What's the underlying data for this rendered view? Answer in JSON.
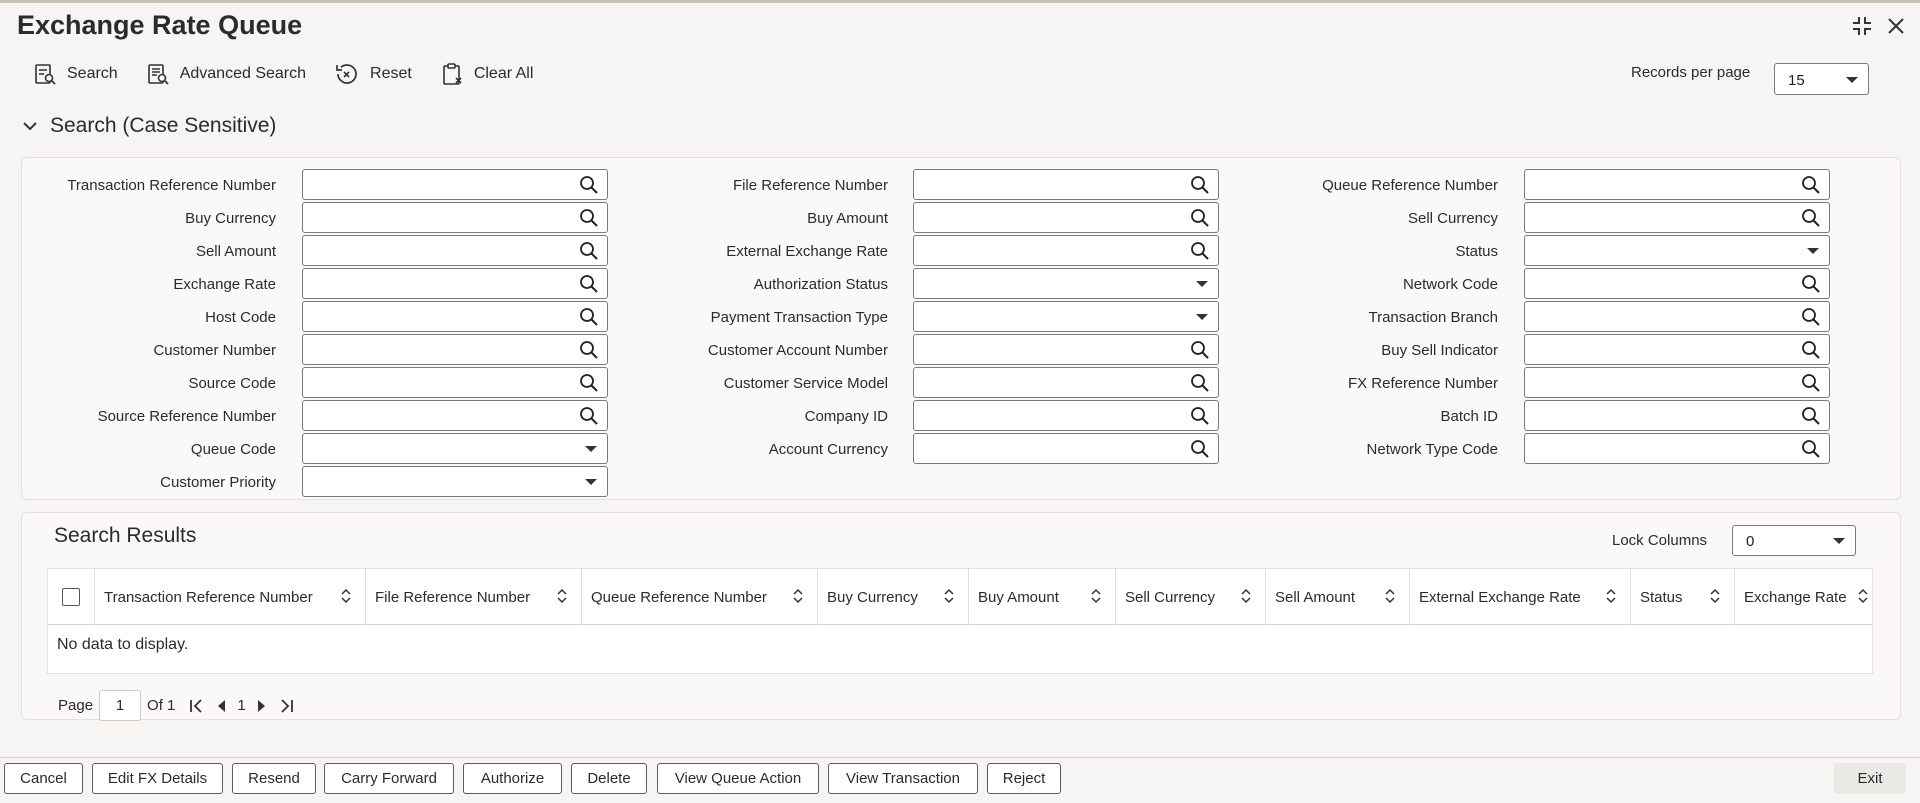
{
  "window": {
    "title": "Exchange Rate Queue"
  },
  "toolbar": {
    "search_label": "Search",
    "advanced_search_label": "Advanced Search",
    "reset_label": "Reset",
    "clear_all_label": "Clear All",
    "records_per_page_label": "Records per page",
    "records_per_page_value": "15"
  },
  "search_section": {
    "title": "Search (Case Sensitive)",
    "fields": {
      "transaction_reference_number": "Transaction Reference Number",
      "buy_currency": "Buy Currency",
      "sell_amount": "Sell Amount",
      "exchange_rate": "Exchange Rate",
      "host_code": "Host Code",
      "customer_number": "Customer Number",
      "source_code": "Source Code",
      "source_reference_number": "Source Reference Number",
      "queue_code": "Queue Code",
      "customer_priority": "Customer Priority",
      "file_reference_number": "File Reference Number",
      "buy_amount": "Buy Amount",
      "external_exchange_rate": "External Exchange Rate",
      "authorization_status": "Authorization Status",
      "payment_transaction_type": "Payment Transaction Type",
      "customer_account_number": "Customer Account Number",
      "customer_service_model": "Customer Service Model",
      "company_id": "Company ID",
      "account_currency": "Account Currency",
      "queue_reference_number": "Queue Reference Number",
      "sell_currency": "Sell Currency",
      "status": "Status",
      "network_code": "Network Code",
      "transaction_branch": "Transaction Branch",
      "buy_sell_indicator": "Buy Sell Indicator",
      "fx_reference_number": "FX Reference Number",
      "batch_id": "Batch ID",
      "network_type_code": "Network Type Code"
    }
  },
  "results": {
    "title": "Search Results",
    "lock_columns_label": "Lock Columns",
    "lock_columns_value": "0",
    "columns": [
      "Transaction Reference Number",
      "File Reference Number",
      "Queue Reference Number",
      "Buy Currency",
      "Buy Amount",
      "Sell Currency",
      "Sell Amount",
      "External Exchange Rate",
      "Status",
      "Exchange Rate"
    ],
    "no_data": "No data to display.",
    "pagination": {
      "page_label": "Page",
      "page_value": "1",
      "of_label": "Of 1",
      "current": "1"
    }
  },
  "footer": {
    "cancel": "Cancel",
    "edit_fx_details": "Edit FX Details",
    "resend": "Resend",
    "carry_forward": "Carry Forward",
    "authorize": "Authorize",
    "delete": "Delete",
    "view_queue_action": "View Queue Action",
    "view_transaction": "View Transaction",
    "reject": "Reject",
    "exit": "Exit"
  }
}
